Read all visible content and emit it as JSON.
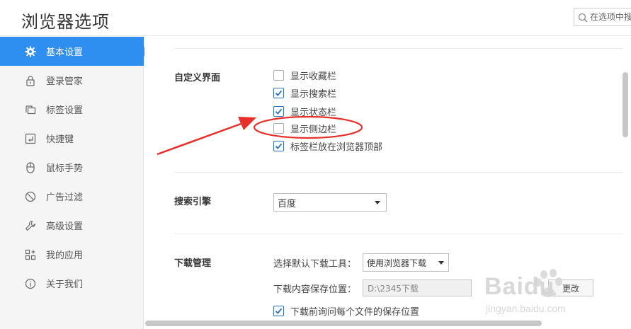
{
  "header": {
    "title": "浏览器选项",
    "search_placeholder": "在选项中搜"
  },
  "sidebar": {
    "items": [
      {
        "label": "基本设置",
        "icon": "gear-icon",
        "active": true
      },
      {
        "label": "登录管家",
        "icon": "lock-icon"
      },
      {
        "label": "标签设置",
        "icon": "tabs-icon"
      },
      {
        "label": "快捷键",
        "icon": "keyboard-icon"
      },
      {
        "label": "鼠标手势",
        "icon": "mouse-icon"
      },
      {
        "label": "广告过滤",
        "icon": "block-icon"
      },
      {
        "label": "高级设置",
        "icon": "wrench-icon"
      },
      {
        "label": "我的应用",
        "icon": "apps-icon"
      },
      {
        "label": "关于我们",
        "icon": "info-icon"
      }
    ]
  },
  "custom_ui": {
    "label": "自定义界面",
    "options": [
      {
        "label": "显示收藏栏",
        "checked": false
      },
      {
        "label": "显示搜索栏",
        "checked": true
      },
      {
        "label": "显示状态栏",
        "checked": true
      },
      {
        "label": "显示侧边栏",
        "checked": false
      },
      {
        "label": "标签栏放在浏览器顶部",
        "checked": true
      }
    ]
  },
  "search_engine": {
    "label": "搜索引擎",
    "selected": "百度"
  },
  "download": {
    "label": "下载管理",
    "tool_label": "选择默认下载工具：",
    "tool_selected": "使用浏览器下载",
    "path_label": "下载内容保存位置：",
    "path_value": "D:\\2345下载",
    "change_label": "更改",
    "ask_label": "下载前询问每个文件的保存位置",
    "ask_checked": true
  },
  "watermark": {
    "brand": "Baidu",
    "site": "jingyan.baidu.com"
  },
  "colors": {
    "accent": "#2e8ff0",
    "annotation": "#e8302a"
  }
}
